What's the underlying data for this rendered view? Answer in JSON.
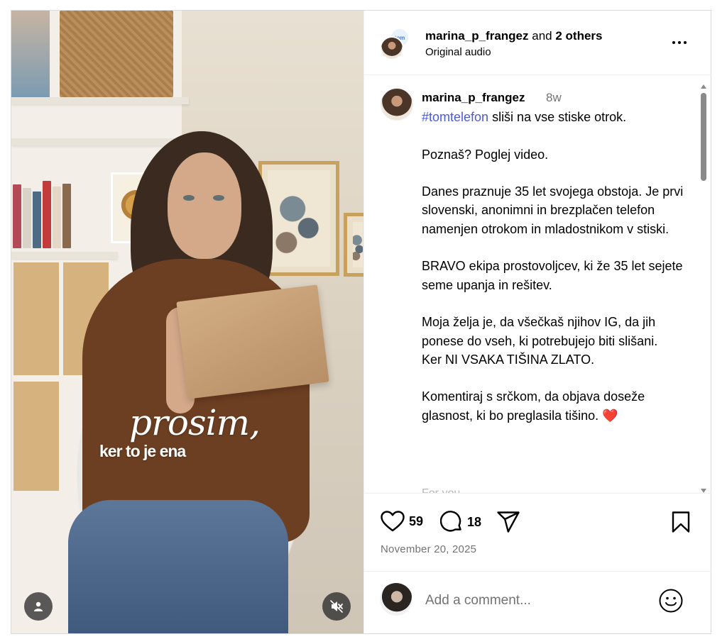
{
  "post": {
    "header": {
      "author": "marina_p_frangez",
      "and_text": "and",
      "others": "2 others",
      "audio": "Original audio",
      "collab_avatar_text": "tom"
    },
    "video": {
      "overlay_script": "prosim,",
      "overlay_sans": "ker to je ena"
    },
    "caption": {
      "username": "marina_p_frangez",
      "time_ago": "8w",
      "hashtag": "#tomtelefon",
      "line1_rest": " sliši na vse stiske otrok.",
      "p2": "Poznaš? Poglej video.",
      "p3": "Danes praznuje 35 let svojega obstoja. Je prvi slovenski, anonimni in brezplačen telefon namenjen otrokom in mladostnikom v stiski.",
      "p4": "BRAVO ekipa prostovoljcev, ki že 35 let sejete seme upanja in rešitev.",
      "p5a": "Moja želja je, da všečkaš njihov IG, da jih ponese do vseh, ki potrebujejo biti slišani.",
      "p5b": "Ker NI VSAKA TIŠINA ZLATO.",
      "p6": "Komentiraj s srčkom, da objava doseže glasnost, ki bo preglasila tišino.",
      "heart": "❤️",
      "for_you": "For you ⌄"
    },
    "actions": {
      "likes": "59",
      "comments": "18",
      "date": "November 20, 2025"
    },
    "comment_box": {
      "placeholder": "Add a comment..."
    }
  },
  "icons": {
    "like": "heart-outline-icon",
    "comment": "speech-bubble-icon",
    "share": "paper-plane-icon",
    "save": "bookmark-icon",
    "emoji": "smiley-icon",
    "more": "ellipsis-icon",
    "tags": "person-icon",
    "mute": "speaker-muted-icon"
  },
  "colors": {
    "hashtag": "#4a5bd6",
    "secondary_text": "#737373",
    "border": "#dbdbdb"
  }
}
